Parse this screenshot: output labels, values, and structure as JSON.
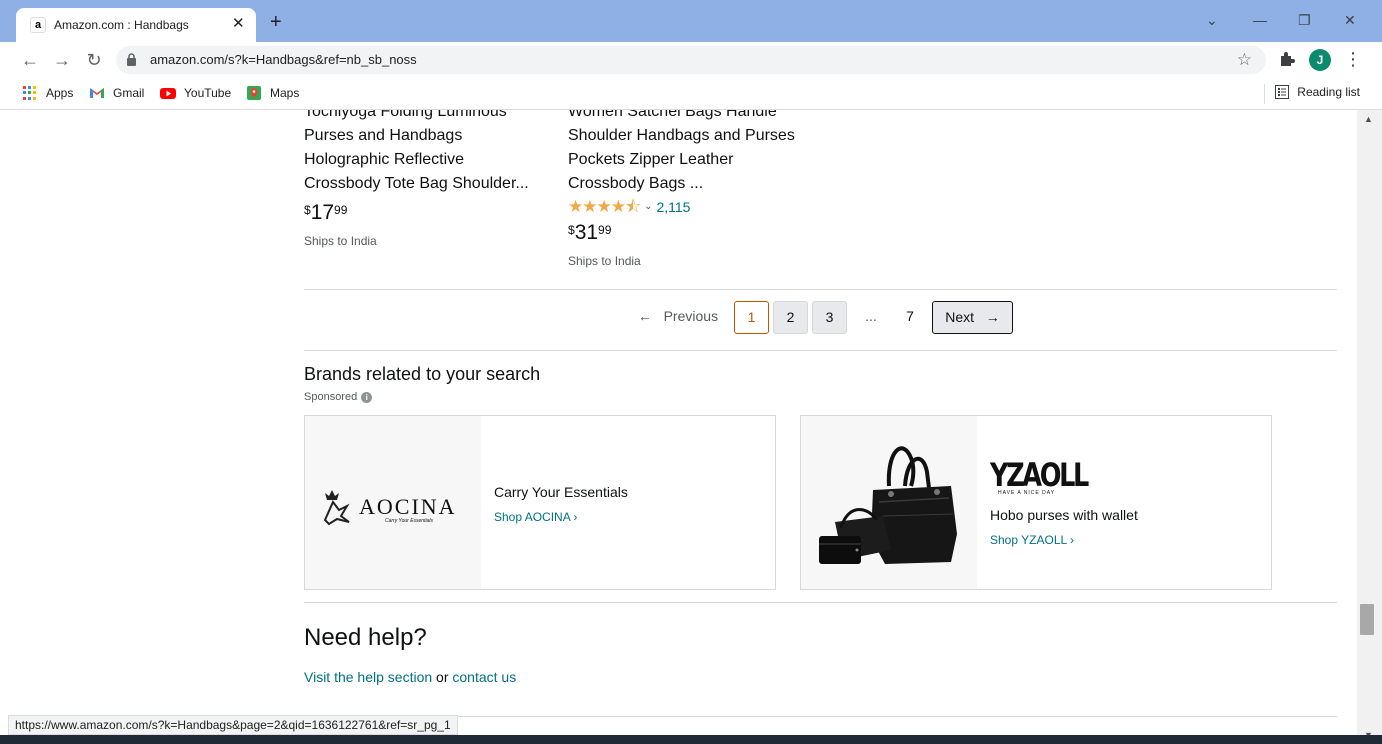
{
  "browser": {
    "tab_title": "Amazon.com : Handbags",
    "tab_favicon": "a",
    "new_tab": "+",
    "url": "amazon.com/s?k=Handbags&ref=nb_sb_noss",
    "profile_initial": "J",
    "bookmarks": [
      "Apps",
      "Gmail",
      "YouTube",
      "Maps"
    ],
    "reading_list": "Reading list",
    "status_url": "https://www.amazon.com/s?k=Handbags&page=2&qid=1636122761&ref=sr_pg_1"
  },
  "products": [
    {
      "title_lines": [
        "Tocniyoga Folding Luminous",
        "Purses and Handbags",
        "Holographic Reflective",
        "Crossbody Tote Bag Shoulder..."
      ],
      "price_symbol": "$",
      "price_whole": "17",
      "price_fraction": "99",
      "ships": "Ships to India"
    },
    {
      "title_lines": [
        "Women Satchel Bags Handle",
        "Shoulder Handbags and Purses",
        "Pockets Zipper Leather",
        "Crossbody Bags ..."
      ],
      "rating_stars": 4.5,
      "rating_count": "2,115",
      "price_symbol": "$",
      "price_whole": "31",
      "price_fraction": "99",
      "ships": "Ships to India"
    }
  ],
  "pagination": {
    "previous": "Previous",
    "pages": [
      "1",
      "2",
      "3"
    ],
    "ellipsis": "...",
    "last": "7",
    "next": "Next",
    "current": "1"
  },
  "brands": {
    "heading": "Brands related to your search",
    "sponsored": "Sponsored",
    "cards": [
      {
        "logo": "AOCINA",
        "logo_tagline": "Carry Your Essentials",
        "tagline": "Carry Your Essentials",
        "link": "Shop AOCINA ›"
      },
      {
        "logo": "YZAOLL",
        "logo_tagline": "HAVE A NICE DAY",
        "tagline": "Hobo purses with wallet",
        "link": "Shop YZAOLL ›"
      }
    ]
  },
  "help": {
    "heading": "Need help?",
    "visit_link": "Visit the help section",
    "or": "or",
    "contact_link": "contact us"
  },
  "colors": {
    "tabbar": "#8fb0e4",
    "link": "#007185",
    "current_page": "#c45500",
    "star": "#f3a847"
  }
}
